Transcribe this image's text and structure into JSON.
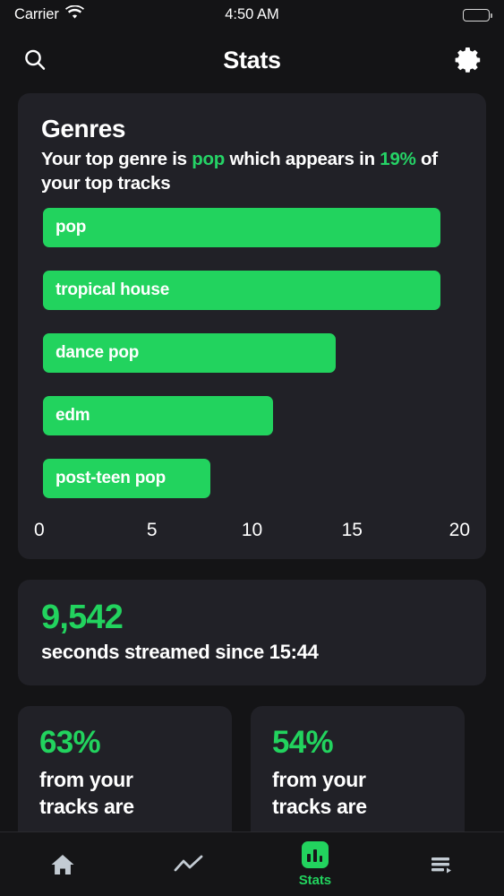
{
  "status_bar": {
    "carrier": "Carrier",
    "wifi_icon": "wifi-icon",
    "time": "4:50 AM",
    "battery_icon": "battery-full-icon"
  },
  "nav_bar": {
    "search_icon": "search-icon",
    "title": "Stats",
    "settings_icon": "gear-icon"
  },
  "genres_card": {
    "title": "Genres",
    "summary_part1": "Your top genre is ",
    "summary_genre": "pop",
    "summary_part2": " which appears in ",
    "summary_percent": "19%",
    "summary_part3": " of your top tracks"
  },
  "chart_data": {
    "type": "bar",
    "orientation": "horizontal",
    "title": "Genres",
    "categories": [
      "pop",
      "tropical house",
      "dance pop",
      "edm",
      "post-teen pop"
    ],
    "values": [
      19,
      19,
      14,
      11,
      8
    ],
    "xlabel": "",
    "ylabel": "",
    "xlim": [
      0,
      20
    ],
    "ticks": [
      "0",
      "5",
      "10",
      "15",
      "20"
    ],
    "grid": false,
    "legend": false,
    "bar_color": "#22d35e",
    "label_color": "#ffffff"
  },
  "seconds_card": {
    "value": "9,542",
    "text": "seconds streamed since 15:44"
  },
  "percent_cards": [
    {
      "value": "63%",
      "text": "from your\ntracks are"
    },
    {
      "value": "54%",
      "text": "from your\ntracks are"
    }
  ],
  "tab_bar": {
    "tabs": [
      {
        "name": "home",
        "icon": "home-icon",
        "label": "",
        "active": false
      },
      {
        "name": "trends",
        "icon": "trending-line-icon",
        "label": "",
        "active": false
      },
      {
        "name": "stats",
        "icon": "bar-chart-icon",
        "label": "Stats",
        "active": true
      },
      {
        "name": "queue",
        "icon": "queue-playlist-icon",
        "label": "",
        "active": false
      }
    ]
  },
  "colors": {
    "accent_green": "#22d35e",
    "page_background": "#141416",
    "card_background": "#212127",
    "text_primary": "#ffffff",
    "tab_inactive": "#c3cbd3"
  }
}
